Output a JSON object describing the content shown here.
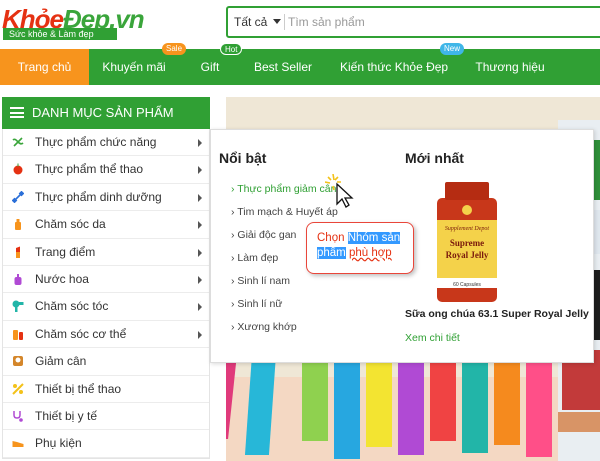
{
  "brand": {
    "name_part1": "Khỏe",
    "name_part2": "Đẹp.vn",
    "tagline": "Sức khỏe & Làm đẹp"
  },
  "search": {
    "category": "Tất cả",
    "placeholder": "Tìm sản phẩm"
  },
  "nav": {
    "items": [
      {
        "label": "Trang chủ",
        "active": true,
        "badge": ""
      },
      {
        "label": "Khuyến mãi",
        "active": false,
        "badge": "Sale",
        "badge_color": "#f7941d"
      },
      {
        "label": "Gift",
        "active": false,
        "badge": "Hot",
        "badge_color": "#30a034"
      },
      {
        "label": "Best Seller",
        "active": false,
        "badge": ""
      },
      {
        "label": "Kiến thức Khỏe Đẹp",
        "active": false,
        "badge": "New",
        "badge_color": "#3fb6e8"
      },
      {
        "label": "Thương hiệu",
        "active": false,
        "badge": ""
      }
    ]
  },
  "sidebar": {
    "title": "DANH MỤC SẢN PHẨM",
    "items": [
      {
        "label": "Thực phẩm chức năng",
        "icon": "herb-icon",
        "arrow": true
      },
      {
        "label": "Thực phẩm thể thao",
        "icon": "apple-icon",
        "arrow": true
      },
      {
        "label": "Thực phẩm dinh dưỡng",
        "icon": "dumbbell-icon",
        "arrow": true
      },
      {
        "label": "Chăm sóc da",
        "icon": "lotion-icon",
        "arrow": true
      },
      {
        "label": "Trang điểm",
        "icon": "lipstick-icon",
        "arrow": true
      },
      {
        "label": "Nước hoa",
        "icon": "perfume-icon",
        "arrow": true
      },
      {
        "label": "Chăm sóc tóc",
        "icon": "hairdryer-icon",
        "arrow": true
      },
      {
        "label": "Chăm sóc cơ thể",
        "icon": "body-care-icon",
        "arrow": true
      },
      {
        "label": "Giảm cân",
        "icon": "scale-icon",
        "arrow": false
      },
      {
        "label": "Thiết bị thể thao",
        "icon": "sport-gear-icon",
        "arrow": false
      },
      {
        "label": "Thiết bị y tế",
        "icon": "stethoscope-icon",
        "arrow": false
      },
      {
        "label": "Phụ kiện",
        "icon": "shoe-icon",
        "arrow": false
      }
    ]
  },
  "flyout": {
    "featured_title": "Nổi bật",
    "links": [
      {
        "label": "› Thực phẩm giảm cân",
        "highlight": true
      },
      {
        "label": "› Tim mạch & Huyết áp",
        "highlight": false
      },
      {
        "label": "› Giải độc gan",
        "highlight": false
      },
      {
        "label": "› Làm đẹp",
        "highlight": false
      },
      {
        "label": "› Sinh lí nam",
        "highlight": false
      },
      {
        "label": "› Sinh lí nữ",
        "highlight": false
      },
      {
        "label": "› Xương khớp",
        "highlight": false
      }
    ],
    "newest_title": "Mới nhất",
    "product": {
      "bottle_brand": "Supplement Depot",
      "bottle_name1": "Supreme",
      "bottle_name2": "Royal Jelly",
      "bottle_count": "60 Capsules",
      "name": "Sữa ong chúa 63.1 Super Royal Jelly",
      "more": "Xem chi tiết"
    }
  },
  "callout": {
    "w1": "Chọn",
    "w2": "Nhóm sản",
    "w3": "phẩm",
    "w4": "phù hợp"
  },
  "colors": {
    "green": "#30a034",
    "orange": "#f7941d",
    "red": "#e53112"
  }
}
